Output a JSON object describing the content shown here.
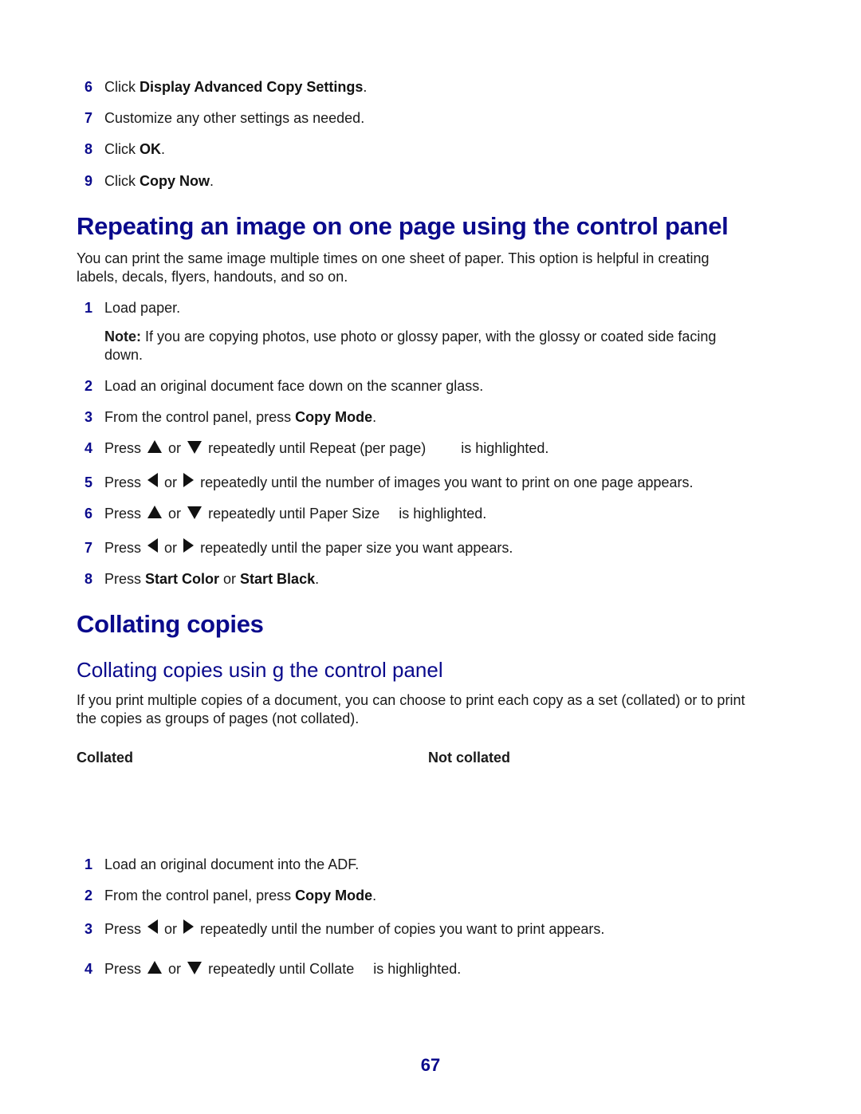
{
  "top_steps": [
    {
      "num": "6",
      "pre": "Click ",
      "bold": "Display Advanced Copy Settings",
      "post": "."
    },
    {
      "num": "7",
      "text": "Customize any other settings as needed."
    },
    {
      "num": "8",
      "pre": "Click ",
      "bold": "OK",
      "post": "."
    },
    {
      "num": "9",
      "pre": "Click ",
      "bold": "Copy Now",
      "post": "."
    }
  ],
  "section1": {
    "heading": "Repeating an image on one page using the control panel",
    "intro_line1": "You can print the same image multiple times on one sheet of paper. This option is helpful in creating",
    "intro_line2": "labels, decals, flyers, handouts, and so on.",
    "steps": {
      "s1": {
        "num": "1",
        "text": "Load paper."
      },
      "note": {
        "label": "Note:",
        "line1": " If you are copying photos, use photo or glossy paper, with the glossy or coated side facing",
        "line2": "down."
      },
      "s2": {
        "num": "2",
        "text": "Load an original document face down on the scanner glass."
      },
      "s3": {
        "num": "3",
        "pre": "From the control panel, press ",
        "bold": "Copy Mode",
        "post": "."
      },
      "s4": {
        "num": "4",
        "press": "Press",
        "or": "or",
        "mid": "repeatedly until Repeat (per page)",
        "end": "is highlighted."
      },
      "s5": {
        "num": "5",
        "press": "Press",
        "or": "or",
        "mid": "repeatedly until the number of images you want to print on one page appears."
      },
      "s6": {
        "num": "6",
        "press": "Press",
        "or": "or",
        "mid": "repeatedly until Paper Size",
        "end": "is highlighted."
      },
      "s7": {
        "num": "7",
        "press": "Press",
        "or": "or",
        "mid": "repeatedly until the paper size you want appears."
      },
      "s8": {
        "num": "8",
        "pre": "Press ",
        "bold1": "Start Color",
        "mid": " or ",
        "bold2": "Start Black",
        "post": "."
      }
    }
  },
  "section2": {
    "heading": "Collating copies",
    "subheading": "Collating copies usin   g the control panel",
    "intro_line1": "If you print multiple copies of a document, you can choose to print each copy as a set (collated) or to print",
    "intro_line2": "the copies as groups of pages (not collated).",
    "col_collated": "Collated",
    "col_not_collated": "Not collated",
    "steps": {
      "s1": {
        "num": "1",
        "text": "Load an original document into the ADF."
      },
      "s2": {
        "num": "2",
        "pre": "From the control panel, press ",
        "bold": "Copy Mode",
        "post": "."
      },
      "s3": {
        "num": "3",
        "press": "Press",
        "or": "or",
        "mid": "repeatedly until the number of copies you want to print appears."
      },
      "s4": {
        "num": "4",
        "press": "Press",
        "or": "or",
        "mid": "repeatedly until Collate",
        "end": "is highlighted."
      }
    }
  },
  "page_number": "67",
  "colors": {
    "heading": "#0a0a8c",
    "text": "#1a1a1a"
  }
}
